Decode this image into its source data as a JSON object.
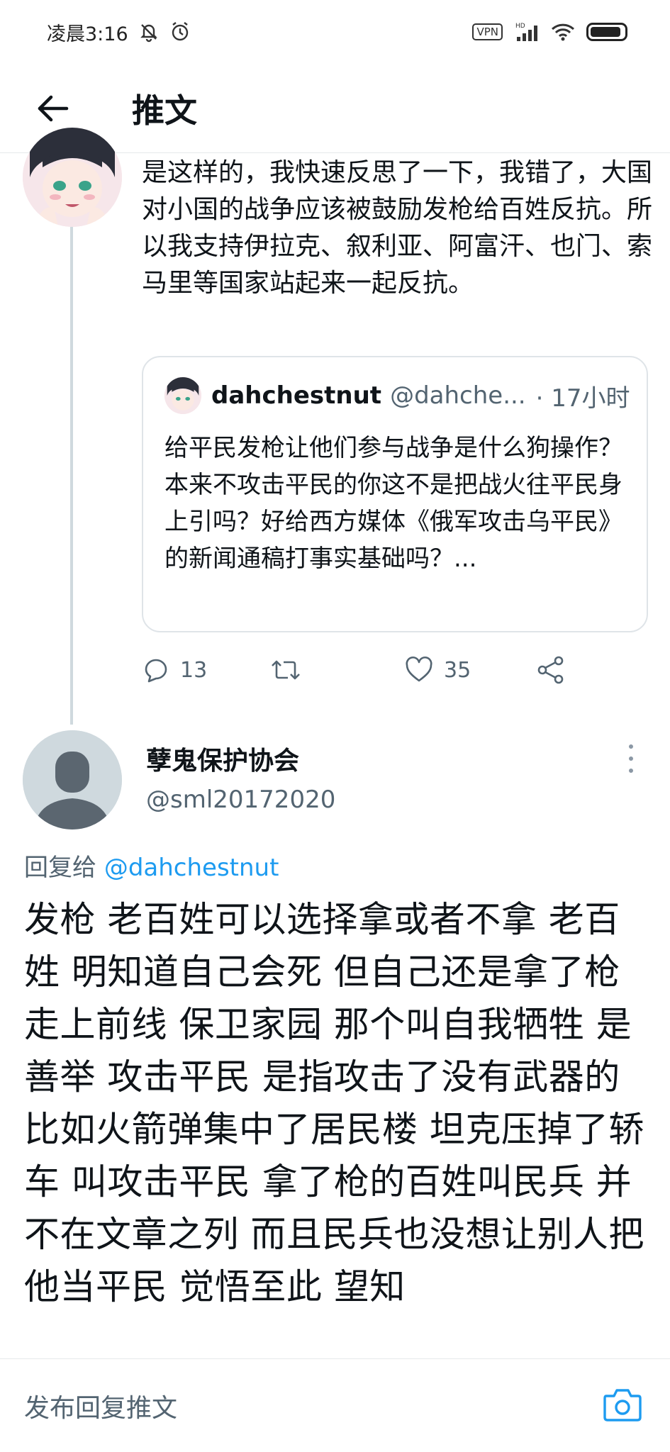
{
  "status_bar": {
    "time": "凌晨3:16",
    "vpn": "VPN",
    "network": "HD"
  },
  "header": {
    "title": "推文"
  },
  "thread": {
    "prev_tweet": {
      "text": "是这样的，我快速反思了一下，我错了，大国对小国的战争应该被鼓励发枪给百姓反抗。所以我支持伊拉克、叙利亚、阿富汗、也门、索马里等国家站起来一起反抗。",
      "quote": {
        "name": "dahchestnut",
        "handle": "@dahche...",
        "time": "· 17小时",
        "text": "给平民发枪让他们参与战争是什么狗操作？本来不攻击平民的你这不是把战火往平民身上引吗？好给西方媒体《俄军攻击乌平民》的新闻通稿打事实基础吗？..."
      },
      "actions": {
        "replies": "13",
        "likes": "35"
      }
    },
    "main_tweet": {
      "name": "孽鬼保护协会",
      "handle": "@sml20172020",
      "reply_prefix": "回复给",
      "reply_to": "@dahchestnut",
      "text": "发枪  老百姓可以选择拿或者不拿 老百姓 明知道自己会死 但自己还是拿了枪走上前线 保卫家园  那个叫自我牺牲 是善举   攻击平民 是指攻击了没有武器的 比如火箭弹集中了居民楼  坦克压掉了轿车  叫攻击平民  拿了枪的百姓叫民兵 并不在文章之列 而且民兵也没想让别人把他当平民  觉悟至此 望知"
    }
  },
  "composer": {
    "placeholder": "发布回复推文"
  },
  "icons": {
    "back": "arrow-left-icon",
    "reply": "reply-icon",
    "retweet": "retweet-icon",
    "like": "heart-icon",
    "share": "share-icon",
    "more": "more-vertical-icon",
    "camera": "camera-icon"
  },
  "colors": {
    "link": "#1d9bf0",
    "secondary_text": "#536471",
    "divider": "#e6e9eb"
  }
}
